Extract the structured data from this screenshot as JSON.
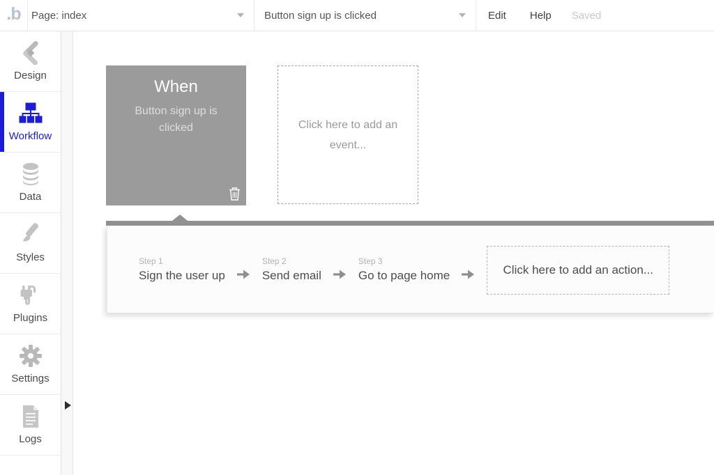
{
  "colors": {
    "accent": "#1b1bd8",
    "event_card_bg": "#9b9b9b",
    "workflow_bar": "#919191"
  },
  "topbar": {
    "logo": ".b",
    "page_dropdown": {
      "value": "Page: index"
    },
    "event_dropdown": {
      "value": "Button sign up is clicked"
    },
    "menu": {
      "edit": "Edit",
      "help": "Help"
    },
    "status": "Saved"
  },
  "sidebar": {
    "items": [
      {
        "label": "Design",
        "icon": "design-tools-icon",
        "selected": false
      },
      {
        "label": "Workflow",
        "icon": "workflow-sitemap-icon",
        "selected": true
      },
      {
        "label": "Data",
        "icon": "database-icon",
        "selected": false
      },
      {
        "label": "Styles",
        "icon": "paintbrush-icon",
        "selected": false
      },
      {
        "label": "Plugins",
        "icon": "plug-icon",
        "selected": false
      },
      {
        "label": "Settings",
        "icon": "gear-icon",
        "selected": false
      },
      {
        "label": "Logs",
        "icon": "document-icon",
        "selected": false
      }
    ]
  },
  "canvas": {
    "event_card": {
      "title": "When",
      "subtitle": "Button sign up is clicked"
    },
    "add_event_label": "Click here to add an event...",
    "workflow": {
      "steps": [
        {
          "label": "Step 1",
          "action": "Sign the user up"
        },
        {
          "label": "Step 2",
          "action": "Send email"
        },
        {
          "label": "Step 3",
          "action": "Go to page home"
        }
      ],
      "add_action_label": "Click here to add an action..."
    }
  }
}
